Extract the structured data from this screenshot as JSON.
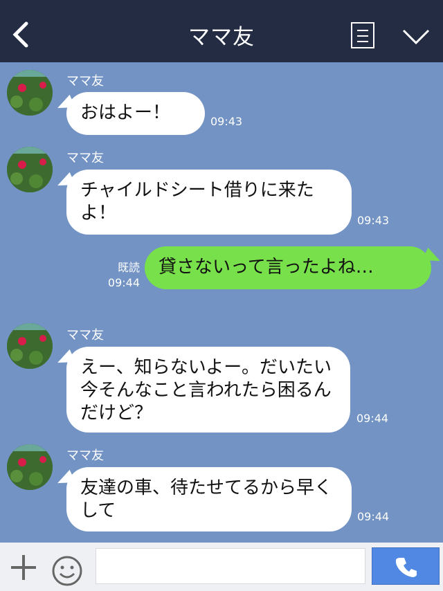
{
  "header": {
    "title": "ママ友",
    "back_icon": "chevron-left-icon",
    "menu_icon": "menu-icon",
    "collapse_icon": "chevron-down-icon"
  },
  "messages": [
    {
      "sender": "ママ友",
      "text": "おはよー！",
      "time": "09:43"
    },
    {
      "sender": "ママ友",
      "text": "チャイルドシート借りに来たよ！",
      "time": "09:43"
    },
    {
      "text": "貸さないって言ったよね…",
      "read": "既読",
      "time": "09:44"
    },
    {
      "sender": "ママ友",
      "text": "えー、知らないよー。だいたい今そんなこと言われたら困るんだけど？",
      "time": "09:44"
    },
    {
      "sender": "ママ友",
      "text": "友達の車、待たせてるから早くして",
      "time": "09:44"
    }
  ],
  "composer": {
    "plus_icon": "plus-icon",
    "emoji_icon": "smiley-icon",
    "call_icon": "phone-icon"
  },
  "colors": {
    "header": "#232c42",
    "background": "#7293c3",
    "outgoing_bubble": "#78e04b",
    "call_button": "#5088e3"
  }
}
